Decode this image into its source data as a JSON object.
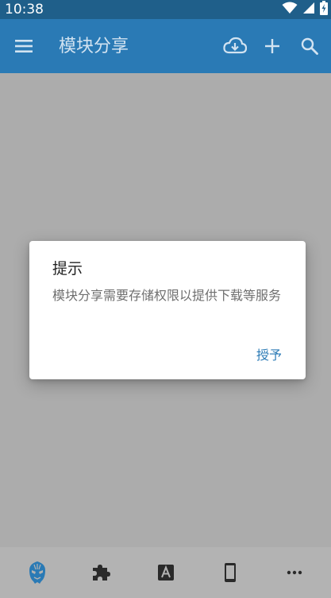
{
  "status_bar": {
    "time": "10:38",
    "icons": [
      "wifi-icon",
      "signal-icon",
      "battery-charging-icon"
    ]
  },
  "app_bar": {
    "title": "模块分享",
    "menu_icon": "menu-icon",
    "actions": [
      "cloud-download-icon",
      "add-icon",
      "search-icon"
    ]
  },
  "dialog": {
    "title": "提示",
    "message": "模块分享需要存储权限以提供下载等服务",
    "positive_button": "授予"
  },
  "bottom_nav": {
    "items": [
      "xposed-mask-icon",
      "puzzle-module-icon",
      "font-a-icon",
      "phone-device-icon",
      "more-horiz-icon"
    ]
  },
  "colors": {
    "status_bar": "#1f5f8a",
    "app_bar": "#2a7ab5",
    "scrim": "#acacac",
    "accent": "#2a7ab5",
    "nav_active": "#2a7ab5"
  }
}
